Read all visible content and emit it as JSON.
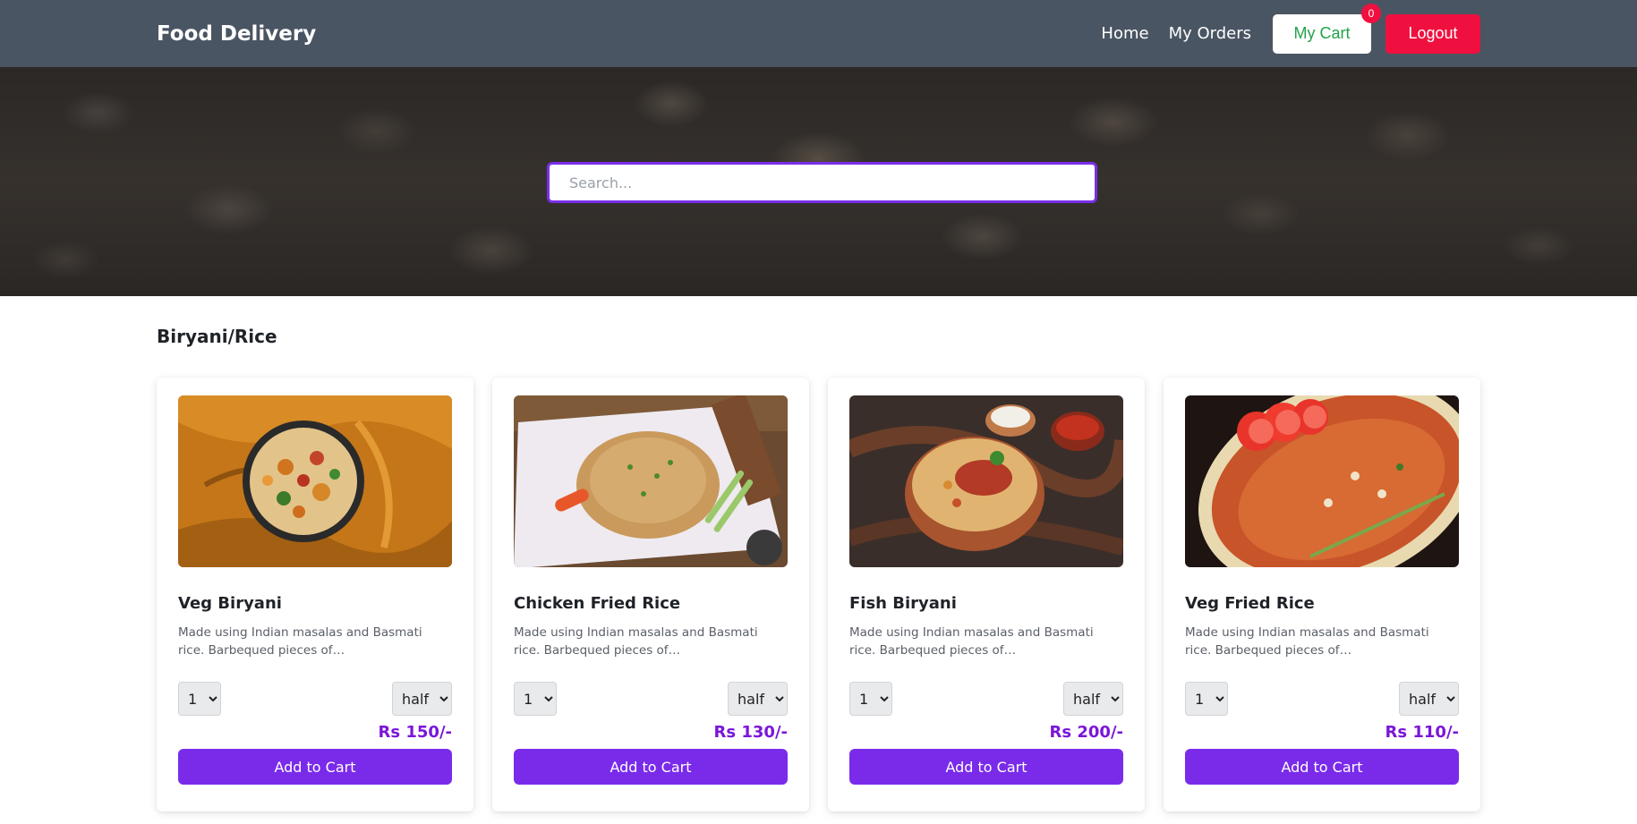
{
  "navbar": {
    "brand": "Food Delivery",
    "links": {
      "home": "Home",
      "orders": "My Orders"
    },
    "cart_label": "My Cart",
    "cart_count": "0",
    "logout_label": "Logout",
    "colors": {
      "bg": "#4a5563",
      "cart_text": "#22a34a",
      "logout_bg": "#f0103f"
    }
  },
  "hero": {
    "search_placeholder": "Search...",
    "search_border": "#7a2fe8"
  },
  "section": {
    "title": "Biryani/Rice",
    "items": [
      {
        "name": "Veg Biryani",
        "description": "Made using Indian masalas and Basmati rice. Barbequed pieces of Paneer/Chicken/Mutton were added.",
        "qty": "1",
        "size": "half",
        "price": "Rs 150/-",
        "button": "Add to Cart",
        "image": "veg-biryani-photo"
      },
      {
        "name": "Chicken Fried Rice",
        "description": "Made using Indian masalas and Basmati rice. Barbequed pieces of Paneer/Chicken/Mutton were added.",
        "qty": "1",
        "size": "half",
        "price": "Rs 130/-",
        "button": "Add to Cart",
        "image": "chicken-fried-rice-photo"
      },
      {
        "name": "Fish Biryani",
        "description": "Made using Indian masalas and Basmati rice. Barbequed pieces of Paneer/Chicken/Mutton were added.",
        "qty": "1",
        "size": "half",
        "price": "Rs 200/-",
        "button": "Add to Cart",
        "image": "fish-biryani-photo"
      },
      {
        "name": "Veg Fried Rice",
        "description": "Made using Indian masalas and Basmati rice. Barbequed pieces of Paneer/Chicken/Mutton were added.",
        "qty": "1",
        "size": "half",
        "price": "Rs 110/-",
        "button": "Add to Cart",
        "image": "veg-fried-rice-photo"
      }
    ],
    "colors": {
      "price": "#7a16d9",
      "button_bg": "#7a2bea"
    }
  }
}
